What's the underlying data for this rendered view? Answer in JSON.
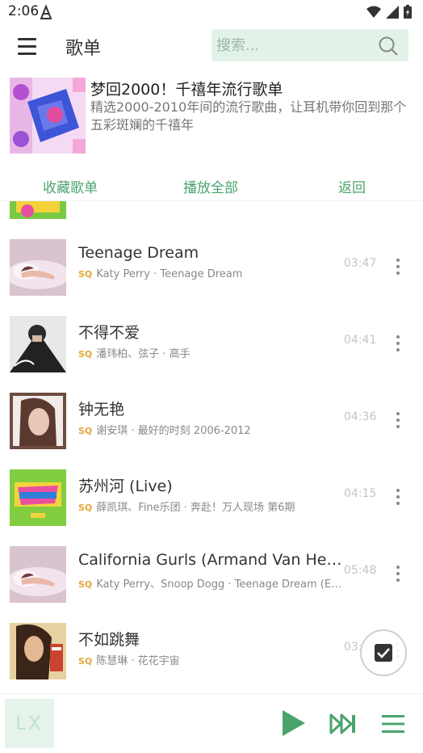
{
  "status": {
    "time": "2:06"
  },
  "header": {
    "title": "歌单",
    "search_placeholder": "搜索..."
  },
  "playlist": {
    "name": "梦回2000！千禧年流行歌单",
    "description": "精选2000-2010年间的流行歌曲，让耳机带你回到那个五彩斑斓的千禧年"
  },
  "actions": {
    "collect": "收藏歌单",
    "play_all": "播放全部",
    "back": "返回"
  },
  "quality_badge": "SQ",
  "songs": [
    {
      "title": "Teenage Dream",
      "meta": "Katy Perry · Teenage Dream",
      "duration": "03:47"
    },
    {
      "title": "不得不爱",
      "meta": "潘玮柏、弦子 · 高手",
      "duration": "04:41"
    },
    {
      "title": "钟无艳",
      "meta": "谢安琪 · 最好的时刻 2006-2012",
      "duration": "04:36"
    },
    {
      "title": "苏州河 (Live)",
      "meta": "薛凯琪、Fine乐团 · 奔赴！万人现场 第6期",
      "duration": "04:15"
    },
    {
      "title": "California Gurls (Armand Van Helden Remix)",
      "meta": "Katy Perry、Snoop Dogg · Teenage Dream (Explicit)",
      "duration": "05:48"
    },
    {
      "title": "不如跳舞",
      "meta": "陈慧琳 · 花花宇宙",
      "duration": "03:12"
    }
  ],
  "player": {
    "logo": "LX"
  },
  "colors": {
    "accent": "#4aa36c",
    "search_bg": "#e2f2e9",
    "sq": "#e3a83a"
  }
}
